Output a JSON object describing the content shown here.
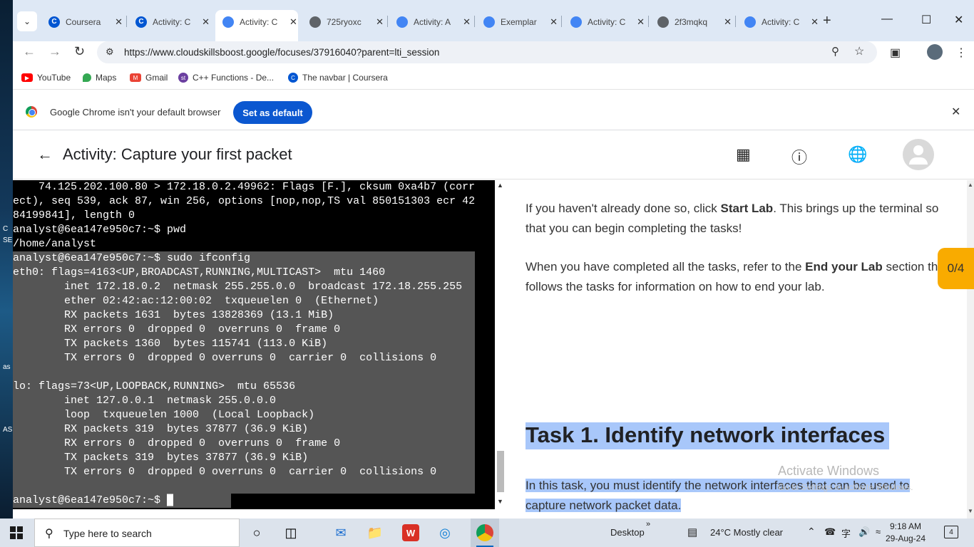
{
  "desktop": {
    "labels": [
      "C",
      "SE",
      "as",
      "AS"
    ]
  },
  "tabs": [
    {
      "title": "Coursera",
      "favicon": "coursera-icon",
      "color": "#0056d2",
      "glyph": "C"
    },
    {
      "title": "Activity: C",
      "favicon": "coursera-icon",
      "color": "#0056d2",
      "glyph": "C"
    },
    {
      "title": "Activity: C",
      "favicon": "google-cloud-icon",
      "color": "#4285f4",
      "glyph": ""
    },
    {
      "title": "725ryoxc",
      "favicon": "globe-icon",
      "color": "#5f6368",
      "glyph": ""
    },
    {
      "title": "Activity: A",
      "favicon": "google-cloud-icon",
      "color": "#4285f4",
      "glyph": ""
    },
    {
      "title": "Exemplar",
      "favicon": "google-cloud-icon",
      "color": "#4285f4",
      "glyph": ""
    },
    {
      "title": "Activity: C",
      "favicon": "google-cloud-icon",
      "color": "#4285f4",
      "glyph": ""
    },
    {
      "title": "2f3mqkq",
      "favicon": "globe-icon",
      "color": "#5f6368",
      "glyph": ""
    },
    {
      "title": "Activity: C",
      "favicon": "google-cloud-icon",
      "color": "#4285f4",
      "glyph": ""
    }
  ],
  "active_tab_index": 2,
  "toolbar": {
    "url": "https://www.cloudskillsboost.google/focuses/37916040?parent=lti_session"
  },
  "bookmarks": [
    {
      "label": "YouTube",
      "icon": "youtube-icon",
      "color": "#ff0000"
    },
    {
      "label": "Maps",
      "icon": "maps-icon",
      "color": "#34a853"
    },
    {
      "label": "Gmail",
      "icon": "gmail-icon",
      "color": "#ea4335"
    },
    {
      "label": "C++ Functions - De...",
      "icon": "studytonight-icon",
      "color": "#6b3fa0"
    },
    {
      "label": "The navbar | Coursera",
      "icon": "coursera-icon",
      "color": "#0056d2"
    }
  ],
  "infobar": {
    "message": "Google Chrome isn't your default browser",
    "button": "Set as default"
  },
  "page": {
    "title": "Activity: Capture your first packet"
  },
  "terminal": {
    "lines": [
      {
        "text": "    74.125.202.100.80 > 172.18.0.2.49962: Flags [F.], cksum 0xa4b7 (corr",
        "selected": false
      },
      {
        "text": "ect), seq 539, ack 87, win 256, options [nop,nop,TS val 850151303 ecr 42",
        "selected": false
      },
      {
        "text": "84199841], length 0",
        "selected": false
      },
      {
        "text": "analyst@6ea147e950c7:~$ pwd",
        "selected": false
      },
      {
        "text": "/home/analyst",
        "selected": false
      },
      {
        "text": "analyst@6ea147e950c7:~$ sudo ifconfig",
        "selected": true
      },
      {
        "text": "eth0: flags=4163<UP,BROADCAST,RUNNING,MULTICAST>  mtu 1460",
        "selected": true
      },
      {
        "text": "        inet 172.18.0.2  netmask 255.255.0.0  broadcast 172.18.255.255",
        "selected": true
      },
      {
        "text": "        ether 02:42:ac:12:00:02  txqueuelen 0  (Ethernet)",
        "selected": true
      },
      {
        "text": "        RX packets 1631  bytes 13828369 (13.1 MiB)",
        "selected": true
      },
      {
        "text": "        RX errors 0  dropped 0  overruns 0  frame 0",
        "selected": true
      },
      {
        "text": "        TX packets 1360  bytes 115741 (113.0 KiB)",
        "selected": true
      },
      {
        "text": "        TX errors 0  dropped 0 overruns 0  carrier 0  collisions 0",
        "selected": true
      },
      {
        "text": "",
        "selected": true
      },
      {
        "text": "lo: flags=73<UP,LOOPBACK,RUNNING>  mtu 65536",
        "selected": true
      },
      {
        "text": "        inet 127.0.0.1  netmask 255.0.0.0",
        "selected": true
      },
      {
        "text": "        loop  txqueuelen 1000  (Local Loopback)",
        "selected": true
      },
      {
        "text": "        RX packets 319  bytes 37877 (36.9 KiB)",
        "selected": true
      },
      {
        "text": "        RX errors 0  dropped 0  overruns 0  frame 0",
        "selected": true
      },
      {
        "text": "        TX packets 319  bytes 37877 (36.9 KiB)",
        "selected": true
      },
      {
        "text": "        TX errors 0  dropped 0 overruns 0  carrier 0  collisions 0",
        "selected": true
      },
      {
        "text": "",
        "selected": true
      },
      {
        "text": "analyst@6ea147e950c7:~$ █",
        "selected": false
      }
    ]
  },
  "instructions": {
    "p1_pre": "If you haven't already done so, click ",
    "p1_bold": "Start Lab",
    "p1_post": ". This brings up the terminal so that you can begin completing the tasks!",
    "p2_pre": "When you have completed all the tasks, refer to the ",
    "p2_bold": "End your Lab",
    "p2_post": " section that follows the tasks for information on how to end your lab.",
    "task_heading": "Task 1. Identify network interfaces",
    "task_text": "In this task, you must identify the network interfaces that can be used to capture network packet data."
  },
  "watermark": {
    "line1": "Activate Windows",
    "line2": "Go to Settings to activate Windows."
  },
  "score": "0/4",
  "taskbar": {
    "search_placeholder": "Type here to search",
    "desktop_label": "Desktop",
    "weather": "24°C  Mostly clear",
    "time": "9:18 AM",
    "date": "29-Aug-24",
    "notifications": "4"
  }
}
